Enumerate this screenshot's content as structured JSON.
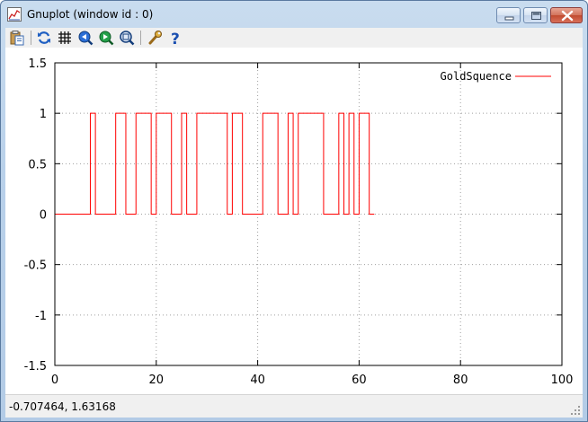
{
  "window": {
    "title": "Gnuplot (window id : 0)"
  },
  "toolbar": {
    "buttons": [
      {
        "name": "copy-to-clipboard",
        "icon": "clipboard-icon"
      },
      {
        "name": "replot",
        "icon": "refresh-icon"
      },
      {
        "name": "toggle-grid",
        "icon": "grid-icon"
      },
      {
        "name": "previous-zoom",
        "icon": "zoom-back-icon"
      },
      {
        "name": "next-zoom",
        "icon": "zoom-forward-icon"
      },
      {
        "name": "autoscale",
        "icon": "zoom-fit-icon"
      },
      {
        "name": "options",
        "icon": "wrench-icon"
      },
      {
        "name": "help",
        "icon": "help-icon"
      }
    ]
  },
  "status": {
    "coords": "-0.707464,  1.63168"
  },
  "chart_data": {
    "type": "line",
    "xlim": [
      0,
      100
    ],
    "ylim": [
      -1.5,
      1.5
    ],
    "xticks": [
      "0",
      "20",
      "40",
      "60",
      "80",
      "100"
    ],
    "yticks": [
      "1.5",
      "1",
      "0.5",
      "0",
      "-0.5",
      "-1",
      "-1.5"
    ],
    "grid": true,
    "legend_position": "top-right",
    "series": [
      {
        "name": "GoldSquence",
        "color": "#ff0000",
        "x": [
          0,
          1,
          2,
          3,
          4,
          5,
          6,
          7,
          8,
          9,
          10,
          11,
          12,
          13,
          14,
          15,
          16,
          17,
          18,
          19,
          20,
          21,
          22,
          23,
          24,
          25,
          26,
          27,
          28,
          29,
          30,
          31,
          32,
          33,
          34,
          35,
          36,
          37,
          38,
          39,
          40,
          41,
          42,
          43,
          44,
          45,
          46,
          47,
          48,
          49,
          50,
          51,
          52,
          53,
          54,
          55,
          56,
          57,
          58,
          59,
          60,
          61,
          62,
          63
        ],
        "y": [
          0,
          0,
          0,
          0,
          0,
          0,
          0,
          1,
          0,
          0,
          0,
          0,
          1,
          1,
          0,
          0,
          1,
          1,
          1,
          0,
          1,
          1,
          1,
          0,
          0,
          1,
          0,
          0,
          1,
          1,
          1,
          1,
          1,
          1,
          0,
          1,
          1,
          0,
          0,
          0,
          0,
          1,
          1,
          1,
          0,
          0,
          1,
          0,
          1,
          1,
          1,
          1,
          1,
          0,
          0,
          0,
          1,
          0,
          1,
          0,
          1,
          1,
          0,
          0
        ]
      }
    ]
  },
  "colors": {
    "plot_line": "#ff0000",
    "grid": "#a0a0a0",
    "axes": "#000000"
  }
}
